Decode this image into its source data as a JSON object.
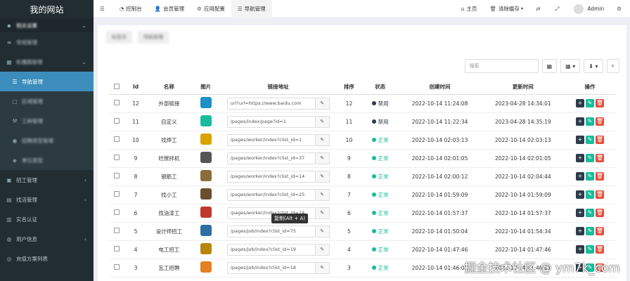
{
  "sidebar": {
    "title": "我的网站",
    "items": [
      {
        "icon": "square-icon",
        "label": "相关设置",
        "kind": "top blur",
        "arrow": "⌄"
      },
      {
        "icon": "bars-icon",
        "label": "常规管理",
        "kind": "blur",
        "arrow": ""
      },
      {
        "icon": "grid-icon",
        "label": "轮播图管理",
        "kind": "blur",
        "arrow": "⌄"
      },
      {
        "icon": "list-icon",
        "label": "导航管理",
        "kind": "sub active",
        "arrow": ""
      },
      {
        "icon": "map-icon",
        "label": "区域管理",
        "kind": "sub blur",
        "arrow": ""
      },
      {
        "icon": "tool-icon",
        "label": "工种管理",
        "kind": "sub blur",
        "arrow": ""
      },
      {
        "icon": "user-icon",
        "label": "招聘类型管理",
        "kind": "sub blur",
        "arrow": ""
      },
      {
        "icon": "tag-icon",
        "label": "单位类型",
        "kind": "sub blur",
        "arrow": ""
      },
      {
        "icon": "worker-icon",
        "label": "招工管理",
        "kind": "",
        "arrow": "‹"
      },
      {
        "icon": "job-icon",
        "label": "找活管理",
        "kind": "",
        "arrow": "‹"
      },
      {
        "icon": "id-icon",
        "label": "实名认证",
        "kind": "",
        "arrow": ""
      },
      {
        "icon": "users-icon",
        "label": "用户信息",
        "kind": "",
        "arrow": "‹"
      },
      {
        "icon": "recharge-icon",
        "label": "充值方案列表",
        "kind": "",
        "arrow": ""
      }
    ]
  },
  "topbar": {
    "nav": [
      {
        "icon": "menu-icon",
        "glyph": "☰",
        "label": ""
      },
      {
        "icon": "dashboard-icon",
        "glyph": "◔",
        "label": "控制台"
      },
      {
        "icon": "member-icon",
        "glyph": "👤",
        "label": "会员管理"
      },
      {
        "icon": "config-icon",
        "glyph": "⚙",
        "label": "应用配置"
      },
      {
        "icon": "nav-icon",
        "glyph": "☰",
        "label": "导航管理"
      }
    ],
    "home": "主页",
    "clear_cache": "清除缓存",
    "user": "Admin"
  },
  "tabs": [
    "标签页",
    "导航管理"
  ],
  "toolbar": {
    "search_placeholder": "搜索"
  },
  "table": {
    "headers": [
      "",
      "Id",
      "名称",
      "图片",
      "链接地址",
      "排序",
      "状态",
      "创建时间",
      "更新时间",
      "操作"
    ],
    "rows": [
      {
        "id": "12",
        "name": "外部链接",
        "color": "#1e90c8",
        "link": "url?url=https://www.baidu.com",
        "sort": "12",
        "status": "禁用",
        "status_color": "#2c3b4a",
        "created": "2022-10-14 11:24:08",
        "updated": "2023-04-28 14:34:01"
      },
      {
        "id": "11",
        "name": "自定义",
        "color": "#18bc9c",
        "link": "/pages/index/page?id=1",
        "sort": "11",
        "status": "禁用",
        "status_color": "#2c3b4a",
        "created": "2022-10-14 11:22:34",
        "updated": "2023-04-28 14:35:19"
      },
      {
        "id": "10",
        "name": "找焊工",
        "color": "#d9a300",
        "link": "/pages/worker/index?clist_id=1",
        "sort": "10",
        "status": "正常",
        "status_color": "#18bc9c",
        "created": "2022-10-14 02:03:13",
        "updated": "2022-10-14 02:03:13"
      },
      {
        "id": "9",
        "name": "砼搅拌机",
        "color": "#555555",
        "link": "/pages/worker/index?clist_id=37",
        "sort": "9",
        "status": "正常",
        "status_color": "#18bc9c",
        "created": "2022-10-14 02:01:05",
        "updated": "2022-10-14 02:01:05"
      },
      {
        "id": "8",
        "name": "钢筋工",
        "color": "#8a6d3b",
        "link": "/pages/worker/index?clist_id=14",
        "sort": "8",
        "status": "正常",
        "status_color": "#18bc9c",
        "created": "2022-10-14 02:00:12",
        "updated": "2022-10-14 02:04:44"
      },
      {
        "id": "7",
        "name": "找小工",
        "color": "#6b4e2e",
        "link": "/pages/worker/index?clist_id=25",
        "sort": "7",
        "status": "正常",
        "status_color": "#18bc9c",
        "created": "2022-10-14 01:59:09",
        "updated": "2022-10-14 01:59:09"
      },
      {
        "id": "6",
        "name": "找油漆工",
        "color": "#c0392b",
        "link": "/pages/worker/index?clist_id=24",
        "sort": "6",
        "status": "正常",
        "status_color": "#18bc9c",
        "created": "2022-10-14 01:57:37",
        "updated": "2022-10-14 01:57:37"
      },
      {
        "id": "5",
        "name": "设计师招工",
        "color": "#2d6fa3",
        "link": "/pages/job/index?clist_id=75",
        "sort": "5",
        "status": "正常",
        "status_color": "#18bc9c",
        "created": "2022-10-14 01:50:04",
        "updated": "2022-10-14 01:54:34"
      },
      {
        "id": "4",
        "name": "电工招工",
        "color": "#b8860b",
        "link": "/pages/job/index?clist_id=19",
        "sort": "4",
        "status": "正常",
        "status_color": "#18bc9c",
        "created": "2022-10-14 01:47:46",
        "updated": "2022-10-14 01:47:46"
      },
      {
        "id": "3",
        "name": "瓦工招聘",
        "color": "#e67e22",
        "link": "/pages/job/index?clist_id=18",
        "sort": "3",
        "status": "正常",
        "status_color": "#18bc9c",
        "created": "2022-10-14 01:46:01",
        "updated": "2022-10-14 01:46:01"
      }
    ]
  },
  "tooltip": "复制(Alt + A)",
  "watermark": "掘金技术社区 @ ym7k_com"
}
